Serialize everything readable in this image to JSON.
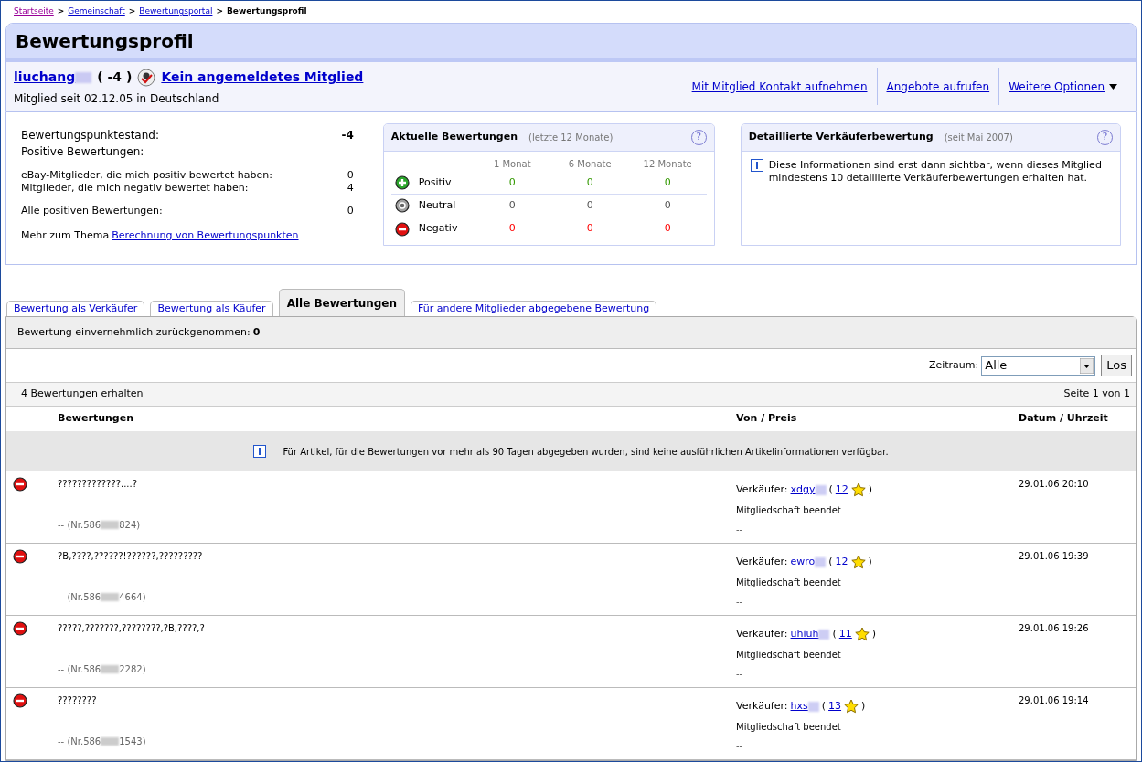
{
  "breadcrumb": [
    {
      "label": "Startseite",
      "visited": true,
      "current": false
    },
    {
      "label": "Gemeinschaft",
      "visited": false,
      "current": false
    },
    {
      "label": "Bewertungsportal",
      "visited": false,
      "current": false
    },
    {
      "label": "Bewertungsprofil",
      "current": true
    }
  ],
  "score_brackets": {
    "open": "(",
    "close": ")"
  },
  "breadcrumb_separator": ">",
  "title": "Bewertungsprofil",
  "member": {
    "name": "liuchang",
    "score": "( -4 )",
    "status_link": "Kein angemeldetes Mitglied",
    "since": "Mitglied seit 02.12.05 in Deutschland"
  },
  "actions": [
    "Mit Mitglied Kontakt aufnehmen",
    "Angebote aufrufen",
    "Weitere Optionen"
  ],
  "summary": {
    "score_label": "Bewertungspunktestand:",
    "score": "-4",
    "positive_label": "Positive Bewertungen:",
    "stats": [
      {
        "label": "eBay-Mitglieder, die mich positiv bewertet haben:",
        "value": "0"
      },
      {
        "label": "Mitglieder, die mich negativ bewertet haben:",
        "value": "4"
      }
    ],
    "all_positive_label": "Alle positiven Bewertungen:",
    "all_positive": "0",
    "more_text": "Mehr zum Thema",
    "more_link": "Berechnung von Bewertungspunkten"
  },
  "recent": {
    "title": "Aktuelle Bewertungen",
    "subtitle": "(letzte 12 Monate)",
    "help": "?",
    "columns": [
      "1 Monat",
      "6 Monate",
      "12 Monate"
    ],
    "rows": [
      {
        "kind": "positive",
        "label": "Positiv",
        "values": [
          "0",
          "0",
          "0"
        ]
      },
      {
        "kind": "neutral",
        "label": "Neutral",
        "values": [
          "0",
          "0",
          "0"
        ]
      },
      {
        "kind": "negative",
        "label": "Negativ",
        "values": [
          "0",
          "0",
          "0"
        ]
      }
    ]
  },
  "detailed": {
    "title": "Detaillierte Verkäuferbewertung",
    "subtitle": "(seit Mai 2007)",
    "help": "?",
    "info": "Diese Informationen sind erst dann sichtbar, wenn dieses Mitglied mindestens 10 detaillierte Verkäuferbewertungen erhalten hat."
  },
  "tabs": [
    {
      "label": "Bewertung als Verkäufer",
      "selected": false
    },
    {
      "label": "Bewertung als Käufer",
      "selected": false
    },
    {
      "label": "Alle Bewertungen",
      "selected": true
    },
    {
      "label": "Für andere Mitglieder abgegebene Bewertung",
      "selected": false
    }
  ],
  "withdrawn": {
    "label": "Bewertung einvernehmlich zurückgenommen:",
    "value": "0"
  },
  "filter": {
    "label": "Zeitraum:",
    "value": "Alle",
    "button": "Los"
  },
  "count": "4 Bewertungen erhalten",
  "page": "Seite 1 von 1",
  "columns": [
    "Bewertungen",
    "Von / Preis",
    "Datum / Uhrzeit"
  ],
  "notice": "Für Artikel, für die Bewertungen vor mehr als 90 Tagen abgegeben wurden, sind keine ausführlichen Artikelinformationen verfügbar.",
  "ratings": [
    {
      "kind": "negative",
      "comment": "?????????????....?",
      "item_prefix": "-- (Nr.586",
      "item_suffix": "824)",
      "role": "Verkäufer:",
      "user": "xdgy",
      "count": "12",
      "membership": "Mitgliedschaft beendet",
      "price": "--",
      "date": "29.01.06 20:10"
    },
    {
      "kind": "negative",
      "comment": "?B,????,??????!??????,?????????",
      "item_prefix": "-- (Nr.586",
      "item_suffix": "4664)",
      "role": "Verkäufer:",
      "user": "ewro",
      "count": "12",
      "membership": "Mitgliedschaft beendet",
      "price": "--",
      "date": "29.01.06 19:39"
    },
    {
      "kind": "negative",
      "comment": "?????,???????,????????,?B,????,?",
      "item_prefix": "-- (Nr.586",
      "item_suffix": "2282)",
      "role": "Verkäufer:",
      "user": "uhiuh",
      "count": "11",
      "membership": "Mitgliedschaft beendet",
      "price": "--",
      "date": "29.01.06 19:26"
    },
    {
      "kind": "negative",
      "comment": "????????",
      "item_prefix": "-- (Nr.586",
      "item_suffix": "1543)",
      "role": "Verkäufer:",
      "user": "hxs",
      "count": "13",
      "membership": "Mitgliedschaft beendet",
      "price": "--",
      "date": "29.01.06 19:14"
    }
  ]
}
